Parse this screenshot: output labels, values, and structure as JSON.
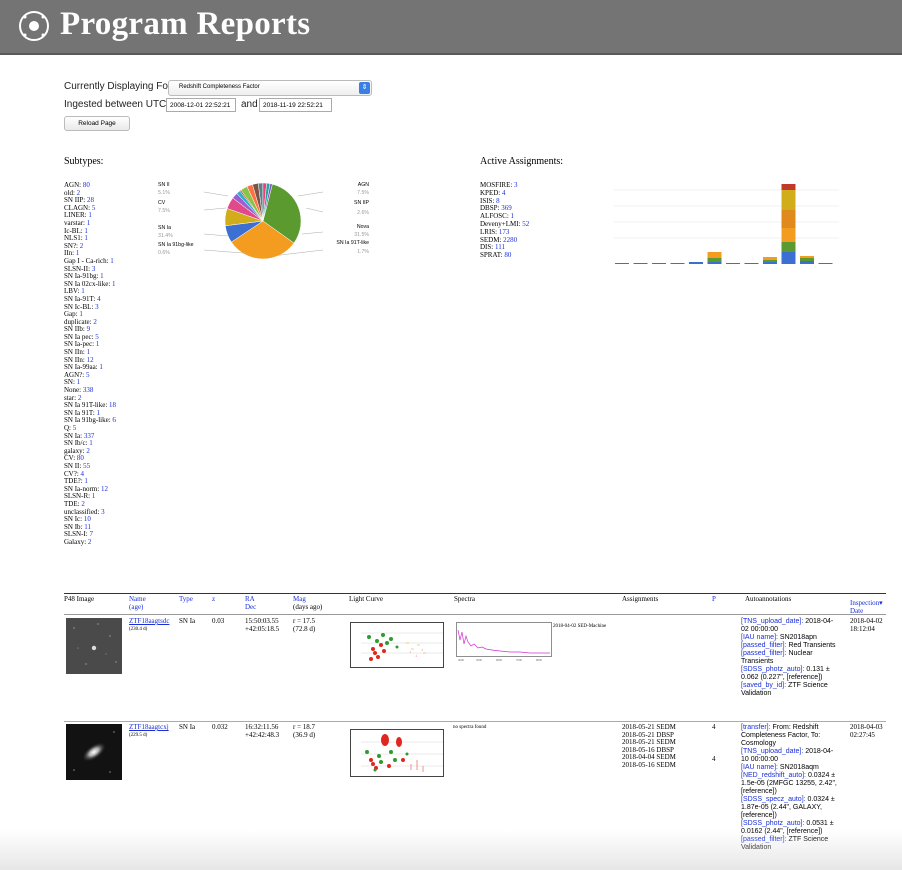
{
  "banner": {
    "title": "Program Reports"
  },
  "controls": {
    "displaying_label": "Currently Displaying For",
    "program_selected": "Redshift Completeness Factor",
    "ingested_label": "Ingested between UTC",
    "start_date": "2008-12-01 22:52:21",
    "and_label": "and",
    "end_date": "2018-11-19 22:52:21",
    "reload_label": "Reload Page"
  },
  "subtypes": {
    "heading": "Subtypes:",
    "items": [
      {
        "name": "AGN:",
        "count": "80"
      },
      {
        "name": "old:",
        "count": "2"
      },
      {
        "name": "SN IIP:",
        "count": "28"
      },
      {
        "name": "CLAGN:",
        "count": "5"
      },
      {
        "name": "LINER:",
        "count": "1"
      },
      {
        "name": "varstar:",
        "count": "1"
      },
      {
        "name": "Ic-BL:",
        "count": "1"
      },
      {
        "name": "NLS1:",
        "count": "1"
      },
      {
        "name": "SN?:",
        "count": "2"
      },
      {
        "name": "IIn:",
        "count": "1"
      },
      {
        "name": "Gap I - Ca-rich:",
        "count": "1"
      },
      {
        "name": "SLSN-II:",
        "count": "3"
      },
      {
        "name": "SN Ia-91bg:",
        "count": "1"
      },
      {
        "name": "SN Ia 02cx-like:",
        "count": "1"
      },
      {
        "name": "LBV:",
        "count": "1"
      },
      {
        "name": "SN Ia-91T:",
        "count": "4"
      },
      {
        "name": "SN Ic-BL:",
        "count": "3"
      },
      {
        "name": "Gap:",
        "count": "1"
      },
      {
        "name": "duplicate:",
        "count": "2"
      },
      {
        "name": "SN IIb:",
        "count": "9"
      },
      {
        "name": "SN Ia pec:",
        "count": "5"
      },
      {
        "name": "SN Ia-pec:",
        "count": "1"
      },
      {
        "name": "SN IIn:",
        "count": "1"
      },
      {
        "name": "SN IIn:",
        "count": "12"
      },
      {
        "name": "SN Ia-99aa:",
        "count": "1"
      },
      {
        "name": "AGN?:",
        "count": "5"
      },
      {
        "name": "SN:",
        "count": "1"
      },
      {
        "name": "None:",
        "count": "338"
      },
      {
        "name": "star:",
        "count": "2"
      },
      {
        "name": "SN Ia 91T-like:",
        "count": "18"
      },
      {
        "name": "SN Ia 91T:",
        "count": "1"
      },
      {
        "name": "SN Ia 91bg-like:",
        "count": "6"
      },
      {
        "name": "Q:",
        "count": "5"
      },
      {
        "name": "SN Ia:",
        "count": "337"
      },
      {
        "name": "SN Ib/c:",
        "count": "1"
      },
      {
        "name": "galaxy:",
        "count": "2"
      },
      {
        "name": "CV:",
        "count": "80"
      },
      {
        "name": "SN II:",
        "count": "55"
      },
      {
        "name": "CV?:",
        "count": "4"
      },
      {
        "name": "TDE?:",
        "count": "1"
      },
      {
        "name": "SN Ia-norm:",
        "count": "12"
      },
      {
        "name": "SLSN-R:",
        "count": "1"
      },
      {
        "name": "TDE:",
        "count": "2"
      },
      {
        "name": "unclassified:",
        "count": "3"
      },
      {
        "name": "SN Ic:",
        "count": "10"
      },
      {
        "name": "SN Ib:",
        "count": "11"
      },
      {
        "name": "SLSN-I:",
        "count": "7"
      },
      {
        "name": "Galaxy:",
        "count": "2"
      }
    ]
  },
  "pie": {
    "labels_left": [
      {
        "name": "SN II",
        "pct": "5.1%"
      },
      {
        "name": "CV",
        "pct": "7.5%"
      },
      {
        "name": "SN Ia",
        "pct": "31.4%"
      },
      {
        "name": "SN Ia 91bg-like",
        "pct": "0.6%"
      }
    ],
    "labels_right": [
      {
        "name": "AGN",
        "pct": "7.5%"
      },
      {
        "name": "SN IIP",
        "pct": "2.6%"
      },
      {
        "name": "Nova",
        "pct": "31.5%"
      },
      {
        "name": "SN Ia 91T-like",
        "pct": "1.7%"
      }
    ],
    "slices": [
      {
        "value": 31.5,
        "color": "#5a9a2e"
      },
      {
        "value": 31.4,
        "color": "#f39c1f"
      },
      {
        "value": 7.5,
        "color": "#3b6fd1"
      },
      {
        "value": 7.5,
        "color": "#d1ad1b"
      },
      {
        "value": 5.1,
        "color": "#e04a8a"
      },
      {
        "value": 2.6,
        "color": "#9d5fd0"
      },
      {
        "value": 1.7,
        "color": "#2bb3c5"
      },
      {
        "value": 0.6,
        "color": "#c0392b"
      },
      {
        "value": 3.0,
        "color": "#8bc34a"
      },
      {
        "value": 2.5,
        "color": "#ff7043"
      },
      {
        "value": 2.5,
        "color": "#795548"
      },
      {
        "value": 2.0,
        "color": "#607d8b"
      },
      {
        "value": 1.6,
        "color": "#ec407a"
      },
      {
        "value": 1.5,
        "color": "#26a69a"
      },
      {
        "value": 1.0,
        "color": "#7e57c2"
      }
    ]
  },
  "assignments": {
    "heading": "Active Assignments:",
    "items": [
      {
        "name": "MOSFIRE:",
        "count": "3"
      },
      {
        "name": "KPED:",
        "count": "4"
      },
      {
        "name": "ISIS:",
        "count": "8"
      },
      {
        "name": "DBSP:",
        "count": "369"
      },
      {
        "name": "ALFOSC:",
        "count": "1"
      },
      {
        "name": "Deveny+LMI:",
        "count": "52"
      },
      {
        "name": "LRIS:",
        "count": "173"
      },
      {
        "name": "SEDM:",
        "count": "2280"
      },
      {
        "name": "DIS:",
        "count": "111"
      },
      {
        "name": "SPRAT:",
        "count": "80"
      }
    ],
    "bar_colors": [
      "#3b6fd1",
      "#5a9a2e",
      "#f39c1f",
      "#e08a1e",
      "#d1ad1b",
      "#c0392b"
    ]
  },
  "table": {
    "headers": {
      "image": "P48 Image",
      "name": "Name",
      "name_sub": "(age)",
      "type": "Type",
      "z": "z",
      "ra": "RA",
      "dec": "Dec",
      "mag": "Mag",
      "mag_sub": "(days ago)",
      "lc": "Light Curve",
      "spectra": "Spectra",
      "assign": "Assignments",
      "p": "P",
      "auto": "Autoannotations",
      "insp": "Inspection▾",
      "date": "Date"
    },
    "rows": [
      {
        "name": "ZTF18aagtsdc",
        "age": "(230.4 d)",
        "type": "SN Ia",
        "z": "0.03",
        "ra": "15:50:03.55",
        "dec": "+42:05:18.5",
        "mag": "r = 17.5",
        "mag_days": "(72.8 d)",
        "spectrum_label": "2018-04-02 SED-Machine",
        "assignments": [],
        "p": "",
        "auto": [
          {
            "k": "[TNS_upload_date]:",
            "v": "2018-04-02 00:00:00"
          },
          {
            "k": "[IAU name]:",
            "v": "SN2018apn"
          },
          {
            "k": "[passed_filter]:",
            "v": "Red Transients"
          },
          {
            "k": "[passed_filter]:",
            "v": "Nuclear Transients"
          },
          {
            "k": "[SDSS_photz_auto]:",
            "v": "0.131 ± 0.062 (0.227\", [reference])"
          },
          {
            "k": "[saved_by_id]:",
            "v": "ZTF Science Validation"
          }
        ],
        "insp_date": "2018-04-02",
        "insp_time": "18:12:04"
      },
      {
        "name": "ZTF18aagtcxj",
        "age": "(229.5 d)",
        "type": "SN Ia",
        "z": "0.032",
        "ra": "16:32:11.56",
        "dec": "+42:42:48.3",
        "mag": "r = 18.7",
        "mag_days": "(36.9 d)",
        "spectrum_label": "no spectra found",
        "assignments": [
          "2018-05-21 SEDM",
          "2018-05-21 DBSP",
          "2018-05-21 SEDM",
          "2018-05-16 DBSP",
          "2018-04-04 SEDM",
          "2018-05-16 SEDM"
        ],
        "p": "4",
        "p2": "4",
        "auto": [
          {
            "k": "[transfer]:",
            "v": "From: Redshift Completeness Factor, To: Cosmology"
          },
          {
            "k": "[TNS_upload_date]:",
            "v": "2018-04-10 00:00:00"
          },
          {
            "k": "[IAU name]:",
            "v": "SN2018aqm"
          },
          {
            "k": "[NED_redshift_auto]:",
            "v": "0.0324 ± 1.5e-05 (2MFGC 13255, 2.42\", [reference])"
          },
          {
            "k": "[SDSS_specz_auto]:",
            "v": "0.0324 ± 1.87e-05 (2.44\", GALAXY, [reference])"
          },
          {
            "k": "[SDSS_photz_auto]:",
            "v": "0.0531 ± 0.0162 (2.44\", [reference])"
          },
          {
            "k": "[passed_filter]:",
            "v": "ZTF Science Validation"
          }
        ],
        "insp_date": "2018-04-03",
        "insp_time": "02:27:45"
      }
    ]
  }
}
